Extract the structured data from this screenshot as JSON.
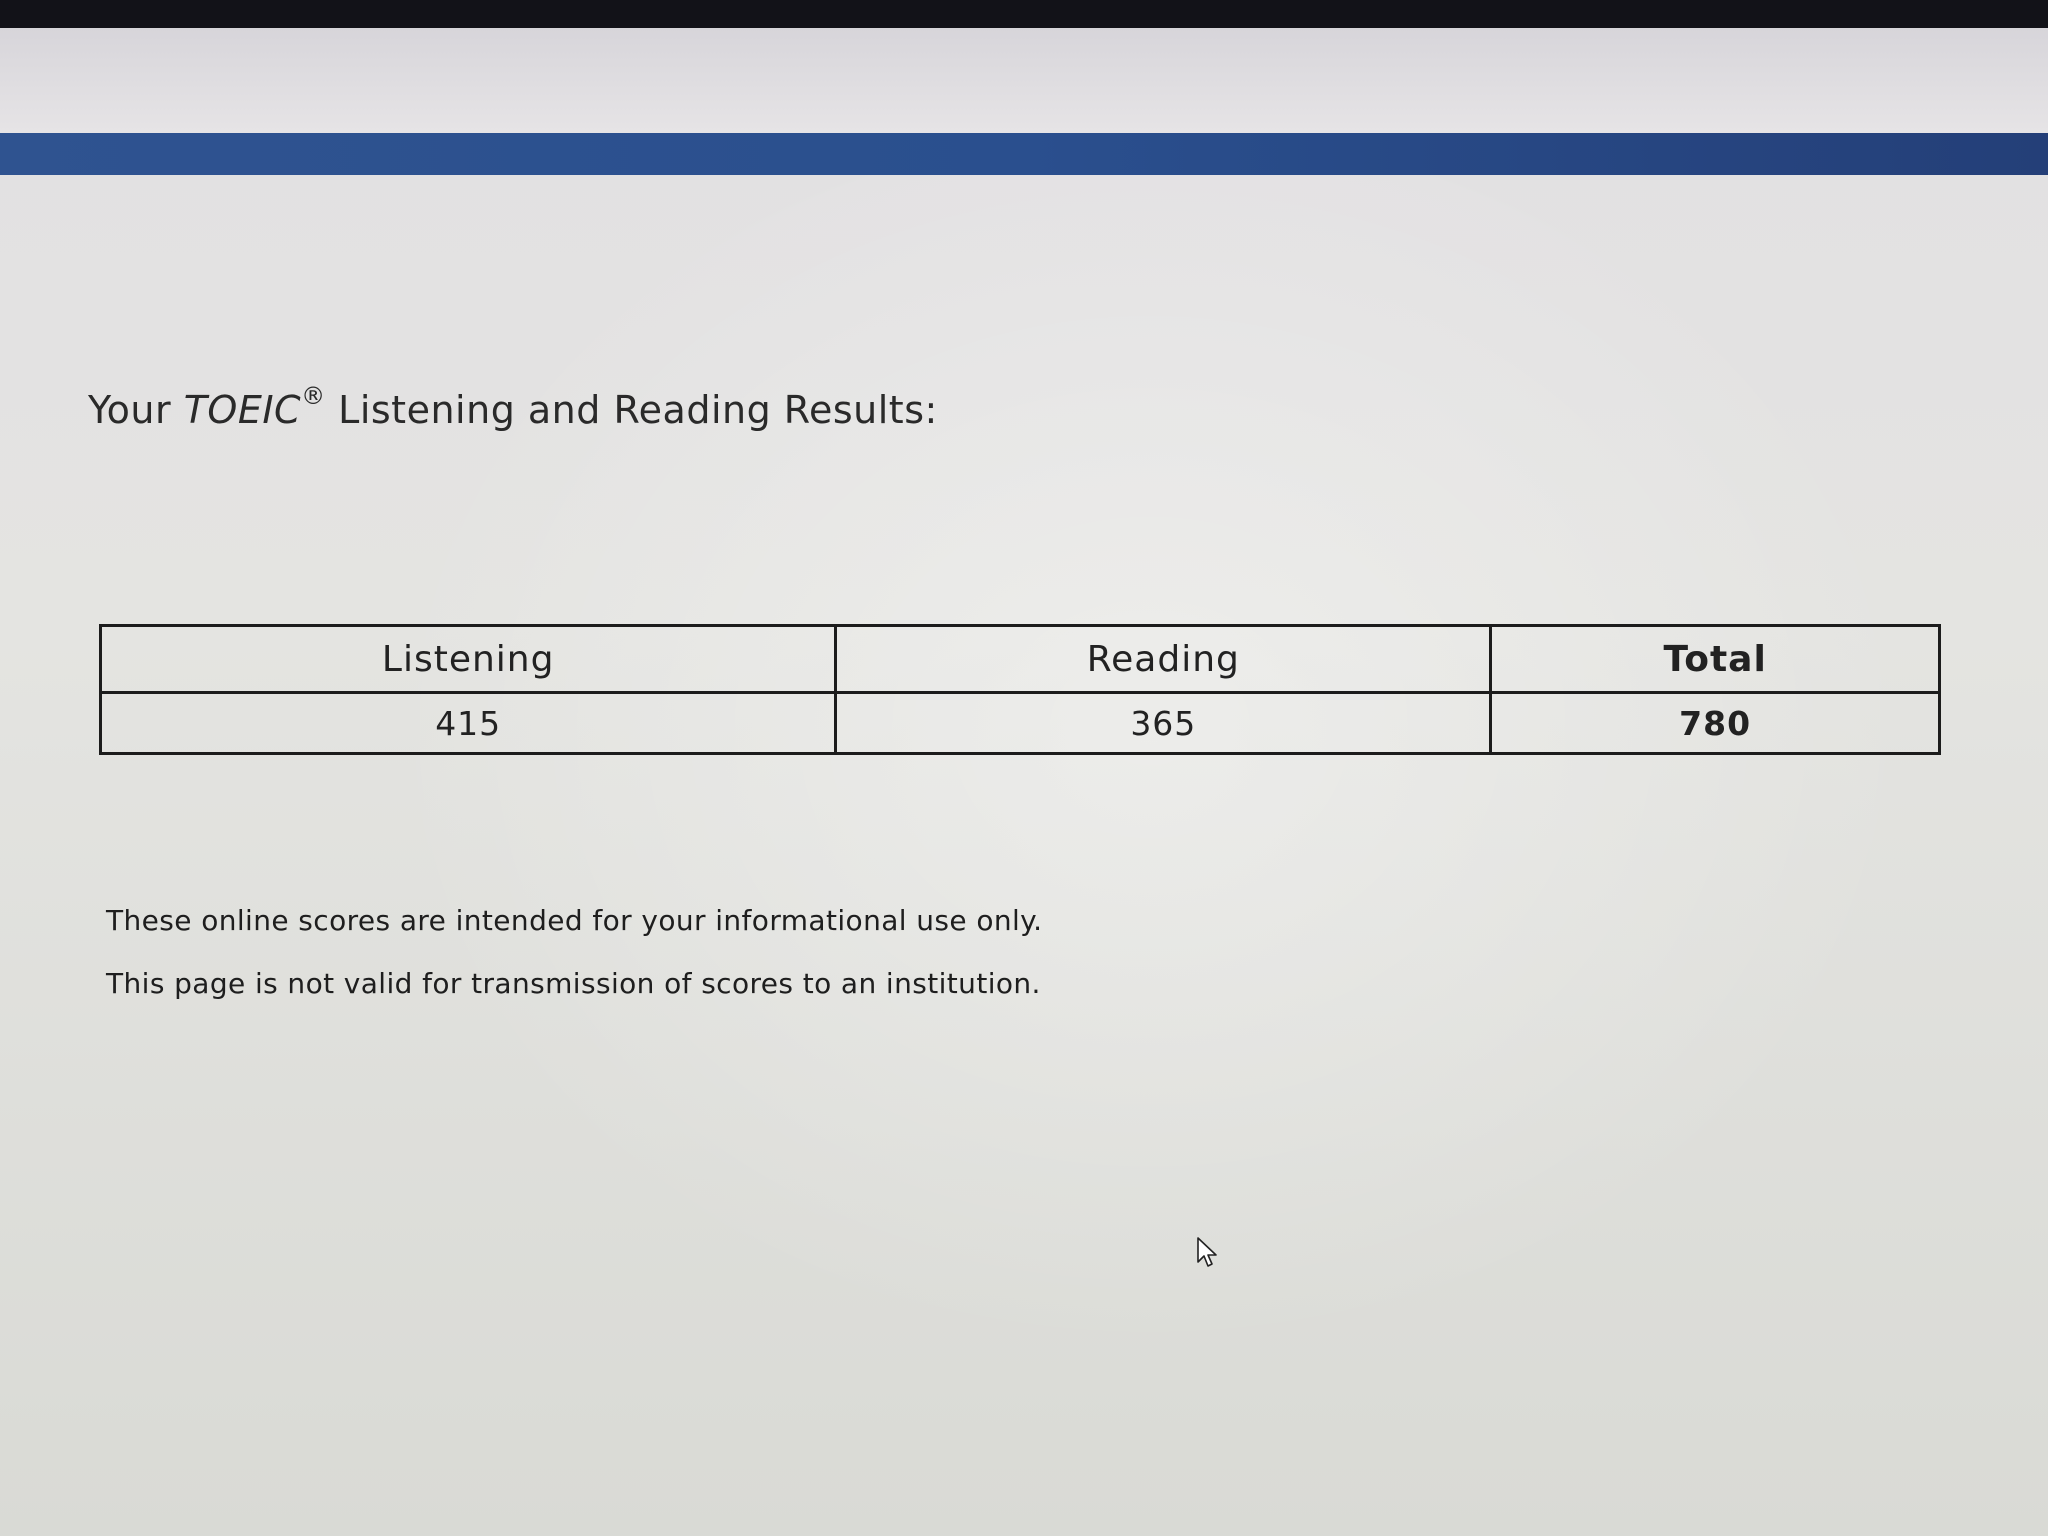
{
  "page": {
    "title_prefix": "Your ",
    "title_brand": "TOEIC",
    "title_mark": "®",
    "title_suffix": " Listening and Reading Results:"
  },
  "scores": {
    "columns": [
      "Listening",
      "Reading",
      "Total"
    ],
    "values": [
      "415",
      "365",
      "780"
    ]
  },
  "notes": [
    "These online scores are intended for your informational use only.",
    "This page is not valid for transmission of scores to an institution."
  ],
  "colors": {
    "header_band": "#2a4f8e",
    "page_background": "#e3e2e0",
    "border": "#1c1c1c"
  }
}
